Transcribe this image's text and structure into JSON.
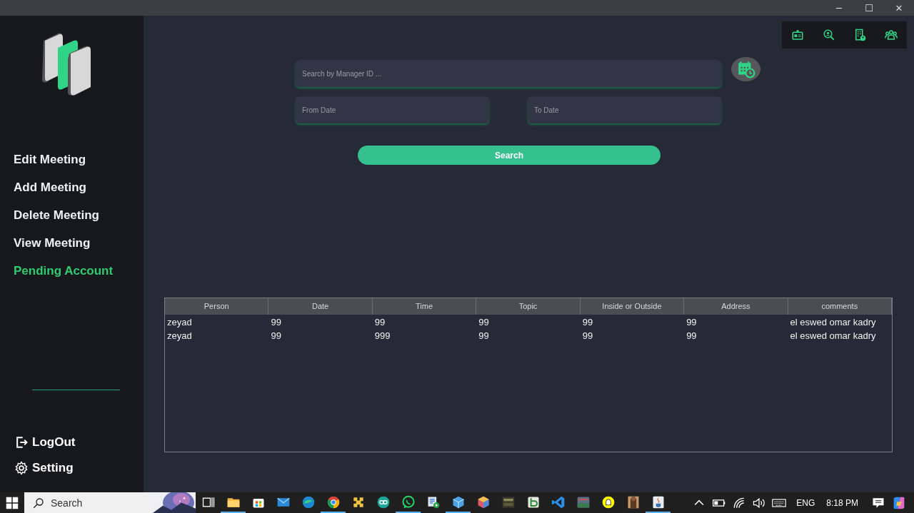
{
  "title_bar": {
    "buttons": [
      "─",
      "☐",
      "✕"
    ]
  },
  "sidebar": {
    "nav": [
      {
        "label": "Edit Meeting",
        "selected": false
      },
      {
        "label": "Add Meeting",
        "selected": false
      },
      {
        "label": "Delete Meeting",
        "selected": false
      },
      {
        "label": "View Meeting",
        "selected": false
      },
      {
        "label": "Pending Account",
        "selected": true
      }
    ],
    "footer": [
      {
        "label": "LogOut",
        "kind": "logout"
      },
      {
        "label": "Setting",
        "kind": "settings"
      }
    ]
  },
  "toolbar": [
    {
      "kind": "id-card"
    },
    {
      "kind": "person-search"
    },
    {
      "kind": "building"
    },
    {
      "kind": "group"
    }
  ],
  "search_form": {
    "manager_id": {
      "placeholder": "Search by Manager ID ..."
    },
    "from_date": {
      "placeholder": "From Date"
    },
    "to_date": {
      "placeholder": "To Date"
    },
    "search_button": "Search"
  },
  "table": {
    "columns": [
      "Person",
      "Date",
      "Time",
      "Topic",
      "Inside or  Outside",
      "Address",
      "comments"
    ],
    "rows": [
      [
        "zeyad",
        "99",
        "99",
        "99",
        "99",
        "99",
        "el eswed omar kadry"
      ],
      [
        "zeyad",
        "99",
        "999",
        "99",
        "99",
        "99",
        "el eswed omar kadry"
      ]
    ]
  },
  "taskbar": {
    "search": {
      "placeholder": "Search"
    },
    "apps": [
      {
        "kind": "task-view",
        "running": false
      },
      {
        "kind": "folder",
        "running": true
      },
      {
        "kind": "store",
        "running": false
      },
      {
        "kind": "mail",
        "running": false
      },
      {
        "kind": "edge",
        "running": false
      },
      {
        "kind": "chrome",
        "running": true
      },
      {
        "kind": "yellow-app",
        "running": false
      },
      {
        "kind": "teal-app",
        "running": false
      },
      {
        "kind": "whatsapp",
        "running": true
      },
      {
        "kind": "media",
        "running": false
      },
      {
        "kind": "cube",
        "running": true
      },
      {
        "kind": "box",
        "running": false
      },
      {
        "kind": "dark-app",
        "running": false
      },
      {
        "kind": "green-app",
        "running": false
      },
      {
        "kind": "code",
        "running": false
      },
      {
        "kind": "photo-app",
        "running": false
      },
      {
        "kind": "ghost",
        "running": false
      },
      {
        "kind": "brown-app",
        "running": false
      },
      {
        "kind": "java",
        "running": true
      }
    ],
    "language": "ENG",
    "time": "8:18 PM"
  }
}
